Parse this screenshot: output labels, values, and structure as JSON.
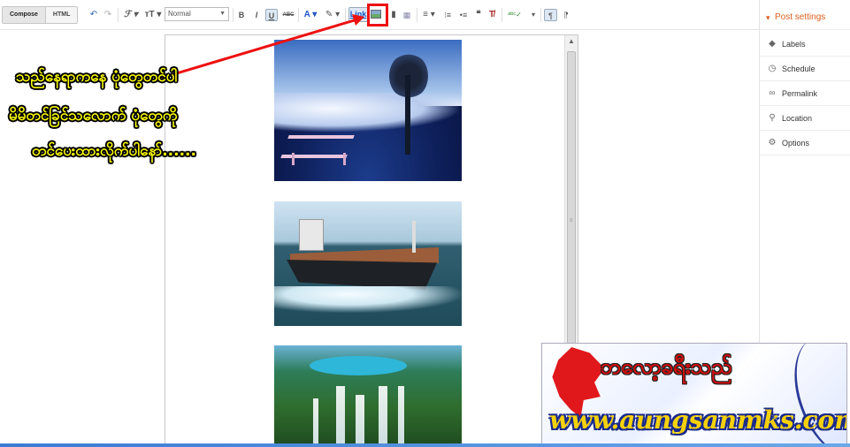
{
  "toolbar": {
    "compose_label": "Compose",
    "html_label": "HTML",
    "undo_icon": "↶",
    "redo_icon": "↷",
    "font_icon": "ℱ ▾",
    "size_icon": "тT ▾",
    "font_select_value": "Normal",
    "bold_label": "B",
    "italic_label": "I",
    "underline_label": "U",
    "strike_label": "ABC",
    "text_color_label": "A ▾",
    "highlight_label": "✎ ▾",
    "link_label": "Link",
    "align_label": "≡ ▾",
    "numbered_label": "⁝≡",
    "bullet_label": "•≡",
    "quote_label": "❝",
    "clear_format_label": "T̸",
    "spellcheck_label": "ᵃᵇᶜ✓",
    "more_label": "▾",
    "ltr_label": "¶",
    "rtl_label": "¶"
  },
  "sidebar": {
    "title": "Post settings",
    "items": [
      {
        "label": "Labels",
        "icon": "tag-icon"
      },
      {
        "label": "Schedule",
        "icon": "clock-icon"
      },
      {
        "label": "Permalink",
        "icon": "link-icon"
      },
      {
        "label": "Location",
        "icon": "pin-icon"
      },
      {
        "label": "Options",
        "icon": "gear-icon"
      }
    ]
  },
  "annotation": {
    "line1": "သည်နေရာကနေ ပုံတွေတင်ပါ",
    "line2": "မိမိတင်ခြင်သလောက် ပုံတွေကို",
    "line3": "တင်ပေးထားလိုက်ပါနော်......",
    "color": "#ffff00"
  },
  "logo": {
    "name": "ဘလော့ခရီးသည်",
    "url": "www.aungsanmks.com",
    "name_color": "#d01010",
    "url_color": "#f6d10a"
  },
  "colors": {
    "accent": "#dd5e1f",
    "highlight_box": "#ee1111",
    "arrow": "#ee1111"
  }
}
